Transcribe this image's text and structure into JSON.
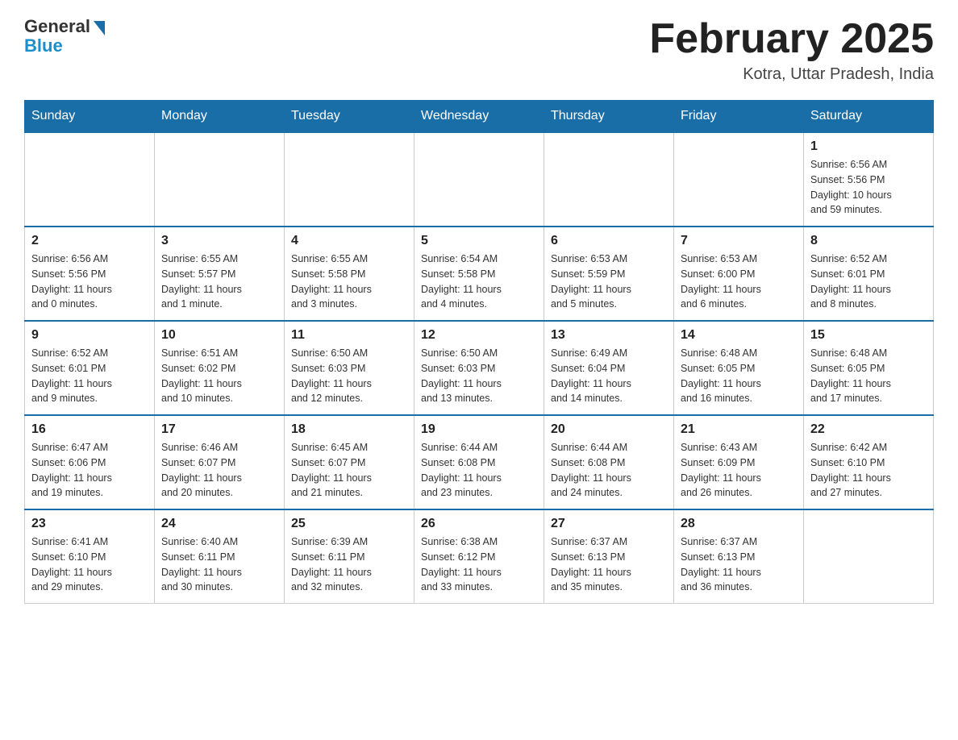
{
  "header": {
    "logo_general": "General",
    "logo_blue": "Blue",
    "month_title": "February 2025",
    "location": "Kotra, Uttar Pradesh, India"
  },
  "weekdays": [
    "Sunday",
    "Monday",
    "Tuesday",
    "Wednesday",
    "Thursday",
    "Friday",
    "Saturday"
  ],
  "weeks": [
    [
      {
        "day": "",
        "info": ""
      },
      {
        "day": "",
        "info": ""
      },
      {
        "day": "",
        "info": ""
      },
      {
        "day": "",
        "info": ""
      },
      {
        "day": "",
        "info": ""
      },
      {
        "day": "",
        "info": ""
      },
      {
        "day": "1",
        "info": "Sunrise: 6:56 AM\nSunset: 5:56 PM\nDaylight: 10 hours\nand 59 minutes."
      }
    ],
    [
      {
        "day": "2",
        "info": "Sunrise: 6:56 AM\nSunset: 5:56 PM\nDaylight: 11 hours\nand 0 minutes."
      },
      {
        "day": "3",
        "info": "Sunrise: 6:55 AM\nSunset: 5:57 PM\nDaylight: 11 hours\nand 1 minute."
      },
      {
        "day": "4",
        "info": "Sunrise: 6:55 AM\nSunset: 5:58 PM\nDaylight: 11 hours\nand 3 minutes."
      },
      {
        "day": "5",
        "info": "Sunrise: 6:54 AM\nSunset: 5:58 PM\nDaylight: 11 hours\nand 4 minutes."
      },
      {
        "day": "6",
        "info": "Sunrise: 6:53 AM\nSunset: 5:59 PM\nDaylight: 11 hours\nand 5 minutes."
      },
      {
        "day": "7",
        "info": "Sunrise: 6:53 AM\nSunset: 6:00 PM\nDaylight: 11 hours\nand 6 minutes."
      },
      {
        "day": "8",
        "info": "Sunrise: 6:52 AM\nSunset: 6:01 PM\nDaylight: 11 hours\nand 8 minutes."
      }
    ],
    [
      {
        "day": "9",
        "info": "Sunrise: 6:52 AM\nSunset: 6:01 PM\nDaylight: 11 hours\nand 9 minutes."
      },
      {
        "day": "10",
        "info": "Sunrise: 6:51 AM\nSunset: 6:02 PM\nDaylight: 11 hours\nand 10 minutes."
      },
      {
        "day": "11",
        "info": "Sunrise: 6:50 AM\nSunset: 6:03 PM\nDaylight: 11 hours\nand 12 minutes."
      },
      {
        "day": "12",
        "info": "Sunrise: 6:50 AM\nSunset: 6:03 PM\nDaylight: 11 hours\nand 13 minutes."
      },
      {
        "day": "13",
        "info": "Sunrise: 6:49 AM\nSunset: 6:04 PM\nDaylight: 11 hours\nand 14 minutes."
      },
      {
        "day": "14",
        "info": "Sunrise: 6:48 AM\nSunset: 6:05 PM\nDaylight: 11 hours\nand 16 minutes."
      },
      {
        "day": "15",
        "info": "Sunrise: 6:48 AM\nSunset: 6:05 PM\nDaylight: 11 hours\nand 17 minutes."
      }
    ],
    [
      {
        "day": "16",
        "info": "Sunrise: 6:47 AM\nSunset: 6:06 PM\nDaylight: 11 hours\nand 19 minutes."
      },
      {
        "day": "17",
        "info": "Sunrise: 6:46 AM\nSunset: 6:07 PM\nDaylight: 11 hours\nand 20 minutes."
      },
      {
        "day": "18",
        "info": "Sunrise: 6:45 AM\nSunset: 6:07 PM\nDaylight: 11 hours\nand 21 minutes."
      },
      {
        "day": "19",
        "info": "Sunrise: 6:44 AM\nSunset: 6:08 PM\nDaylight: 11 hours\nand 23 minutes."
      },
      {
        "day": "20",
        "info": "Sunrise: 6:44 AM\nSunset: 6:08 PM\nDaylight: 11 hours\nand 24 minutes."
      },
      {
        "day": "21",
        "info": "Sunrise: 6:43 AM\nSunset: 6:09 PM\nDaylight: 11 hours\nand 26 minutes."
      },
      {
        "day": "22",
        "info": "Sunrise: 6:42 AM\nSunset: 6:10 PM\nDaylight: 11 hours\nand 27 minutes."
      }
    ],
    [
      {
        "day": "23",
        "info": "Sunrise: 6:41 AM\nSunset: 6:10 PM\nDaylight: 11 hours\nand 29 minutes."
      },
      {
        "day": "24",
        "info": "Sunrise: 6:40 AM\nSunset: 6:11 PM\nDaylight: 11 hours\nand 30 minutes."
      },
      {
        "day": "25",
        "info": "Sunrise: 6:39 AM\nSunset: 6:11 PM\nDaylight: 11 hours\nand 32 minutes."
      },
      {
        "day": "26",
        "info": "Sunrise: 6:38 AM\nSunset: 6:12 PM\nDaylight: 11 hours\nand 33 minutes."
      },
      {
        "day": "27",
        "info": "Sunrise: 6:37 AM\nSunset: 6:13 PM\nDaylight: 11 hours\nand 35 minutes."
      },
      {
        "day": "28",
        "info": "Sunrise: 6:37 AM\nSunset: 6:13 PM\nDaylight: 11 hours\nand 36 minutes."
      },
      {
        "day": "",
        "info": ""
      }
    ]
  ]
}
